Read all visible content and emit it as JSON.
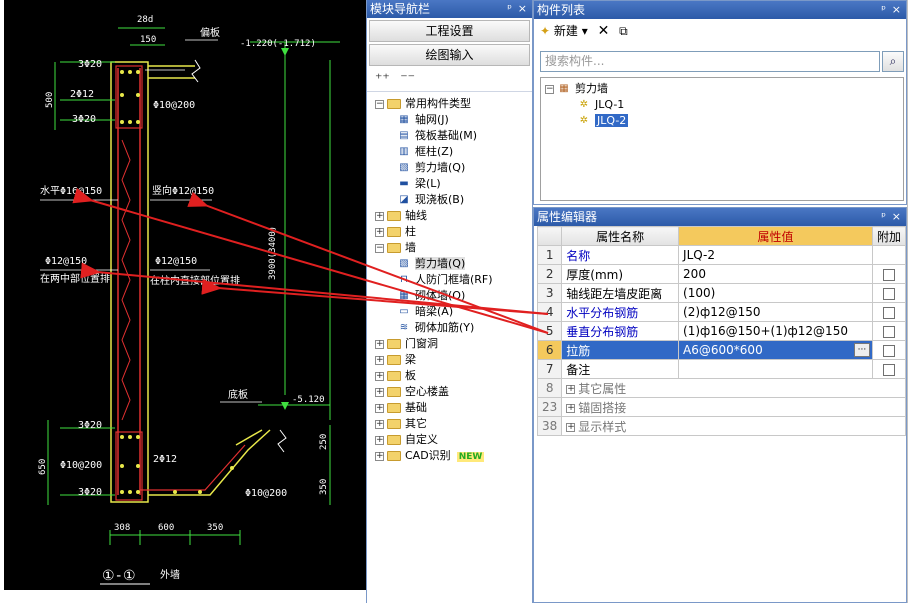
{
  "cad": {
    "dim_top": "28d",
    "dim_150": "150",
    "note_top": "偏板",
    "elev_top": "-1.220(-1.712)",
    "bar_3phi20_a": "3Φ20",
    "bar_2phi12_a": "2Φ12",
    "bar_3phi20_b": "3Φ20",
    "dim_500": "500",
    "stirrup_top": "Φ10@200",
    "horiz_left": "水平Φ16@150",
    "vert_right": "竖向Φ12@150",
    "dist_left": "Φ12@150",
    "dist_left_note": "在两中部位置排",
    "dist_right": "Φ12@150",
    "dist_right_note": "在柱内直接部位置排",
    "dim_vertical": "3900(3400)",
    "note_bottom": "底板",
    "elev_bottom": "-5.120",
    "bar_3phi20_c": "3Φ20",
    "stirrup_bottom": "Φ10@200",
    "bar_2phi12_b": "2Φ12",
    "bar_3phi20_d": "3Φ20",
    "dim_650": "650",
    "dim_250": "250",
    "dim_350a": "350",
    "stirrup_bottom2": "Φ10@200",
    "dim_308": "308",
    "dim_600": "600",
    "dim_350": "350",
    "section_label": "①-①",
    "section_note": "外墙"
  },
  "nav": {
    "title": "模块导航栏",
    "pin": "ᵖ",
    "close": "×",
    "btn_project": "工程设置",
    "btn_draw": "绘图输入",
    "tree": [
      {
        "label": "常用构件类型",
        "level": 0,
        "type": "folder-open",
        "pm": "−"
      },
      {
        "label": "轴网(J)",
        "level": 1,
        "type": "icon",
        "icon": "grid-icon"
      },
      {
        "label": "筏板基础(M)",
        "level": 1,
        "type": "icon",
        "icon": "raft-icon"
      },
      {
        "label": "框柱(Z)",
        "level": 1,
        "type": "icon",
        "icon": "column-icon"
      },
      {
        "label": "剪力墙(Q)",
        "level": 1,
        "type": "icon",
        "icon": "wall-icon"
      },
      {
        "label": "梁(L)",
        "level": 1,
        "type": "icon",
        "icon": "beam-icon"
      },
      {
        "label": "现浇板(B)",
        "level": 1,
        "type": "icon",
        "icon": "slab-icon"
      },
      {
        "label": "轴线",
        "level": 0,
        "type": "folder",
        "pm": "+"
      },
      {
        "label": "柱",
        "level": 0,
        "type": "folder",
        "pm": "+"
      },
      {
        "label": "墙",
        "level": 0,
        "type": "folder-open",
        "pm": "−"
      },
      {
        "label": "剪力墙(Q)",
        "level": 1,
        "type": "icon",
        "icon": "wall-icon"
      },
      {
        "label": "人防门框墙(RF)",
        "level": 1,
        "type": "icon",
        "icon": "door-frame-icon"
      },
      {
        "label": "砌体墙(Q)",
        "level": 1,
        "type": "icon",
        "icon": "masonry-icon"
      },
      {
        "label": "暗梁(A)",
        "level": 1,
        "type": "icon",
        "icon": "hidden-beam-icon"
      },
      {
        "label": "砌体加筋(Y)",
        "level": 1,
        "type": "icon",
        "icon": "rebar-icon"
      },
      {
        "label": "门窗洞",
        "level": 0,
        "type": "folder",
        "pm": "+"
      },
      {
        "label": "梁",
        "level": 0,
        "type": "folder",
        "pm": "+"
      },
      {
        "label": "板",
        "level": 0,
        "type": "folder",
        "pm": "+"
      },
      {
        "label": "空心楼盖",
        "level": 0,
        "type": "folder",
        "pm": "+"
      },
      {
        "label": "基础",
        "level": 0,
        "type": "folder",
        "pm": "+"
      },
      {
        "label": "其它",
        "level": 0,
        "type": "folder",
        "pm": "+"
      },
      {
        "label": "自定义",
        "level": 0,
        "type": "folder",
        "pm": "+"
      },
      {
        "label": "CAD识别",
        "level": 0,
        "type": "folder",
        "pm": "+"
      }
    ],
    "new_badge": "NEW"
  },
  "list": {
    "title": "构件列表",
    "pin": "ᵖ",
    "close": "×",
    "new_label": "新建",
    "search_placeholder": "搜索构件...",
    "root": "剪力墙",
    "items": [
      "JLQ-1",
      "JLQ-2"
    ]
  },
  "props": {
    "title": "属性编辑器",
    "pin": "ᵖ",
    "close": "×",
    "col_name": "属性名称",
    "col_value": "属性值",
    "col_add": "附加",
    "rows": [
      {
        "idx": "1",
        "name": "名称",
        "value": "JLQ-2",
        "blue": true,
        "check": false
      },
      {
        "idx": "2",
        "name": "厚度(mm)",
        "value": "200",
        "blue": false,
        "check": true
      },
      {
        "idx": "3",
        "name": "轴线距左墙皮距离",
        "value": "(100)",
        "blue": false,
        "check": true
      },
      {
        "idx": "4",
        "name": "水平分布钢筋",
        "value": "(2)ф12@150",
        "blue": true,
        "check": true
      },
      {
        "idx": "5",
        "name": "垂直分布钢筋",
        "value": "(1)ф16@150+(1)ф12@150",
        "blue": true,
        "check": true
      },
      {
        "idx": "6",
        "name": "拉筋",
        "value": "A6@600*600",
        "blue": false,
        "check": true
      },
      {
        "idx": "7",
        "name": "备注",
        "value": "",
        "blue": false,
        "check": true
      }
    ],
    "groups": [
      {
        "idx": "8",
        "name": "其它属性"
      },
      {
        "idx": "23",
        "name": "锚固搭接"
      },
      {
        "idx": "38",
        "name": "显示样式"
      }
    ],
    "ellipsis": "···"
  }
}
